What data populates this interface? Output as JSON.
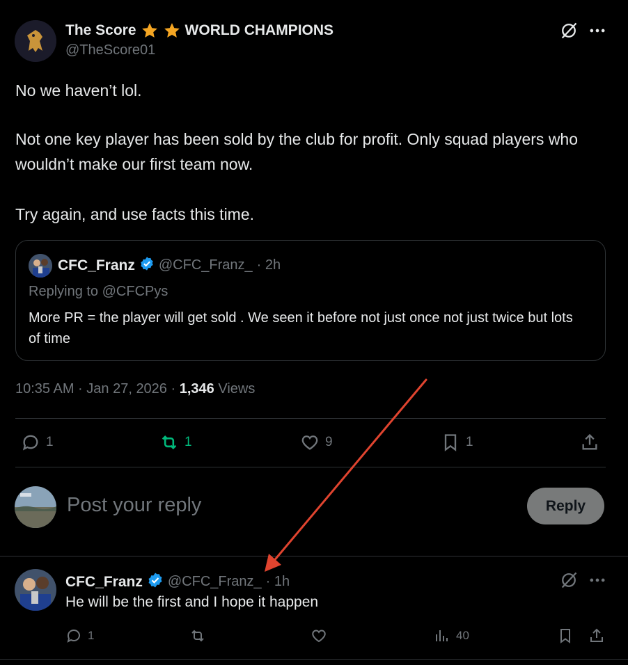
{
  "main_post": {
    "display_name": "The Score",
    "name_suffix": "WORLD CHAMPIONS",
    "handle": "@TheScore01",
    "paragraphs": [
      "No we haven’t lol.",
      "Not one key player has been sold by the club for profit. Only squad players who wouldn’t make our first team now.",
      "Try again, and use facts this time."
    ],
    "timestamp": "10:35 AM · Jan 27, 2026",
    "views_count": "1,346",
    "views_label": "Views"
  },
  "quoted_post": {
    "display_name": "CFC_Franz",
    "handle": "@CFC_Franz_",
    "time": "· 2h",
    "replying_to": "Replying to @CFCPys",
    "text": "More PR = the player will get sold . We seen it before not just once not just twice but lots of time"
  },
  "actions": {
    "replies": "1",
    "reposts": "1",
    "likes": "9",
    "bookmarks": "1"
  },
  "compose": {
    "placeholder": "Post your reply",
    "button": "Reply"
  },
  "reply_post": {
    "display_name": "CFC_Franz",
    "handle": "@CFC_Franz_",
    "time": "· 1h",
    "text": "He will be the first and I hope it happen",
    "replies": "1",
    "views": "40"
  },
  "colors": {
    "background": "#000000",
    "text": "#e7e9ea",
    "muted": "#71767b",
    "repost_active": "#00ba7c",
    "verified": "#1d9bf0",
    "annotation_arrow": "#e0442f",
    "star": "#f5a623"
  }
}
